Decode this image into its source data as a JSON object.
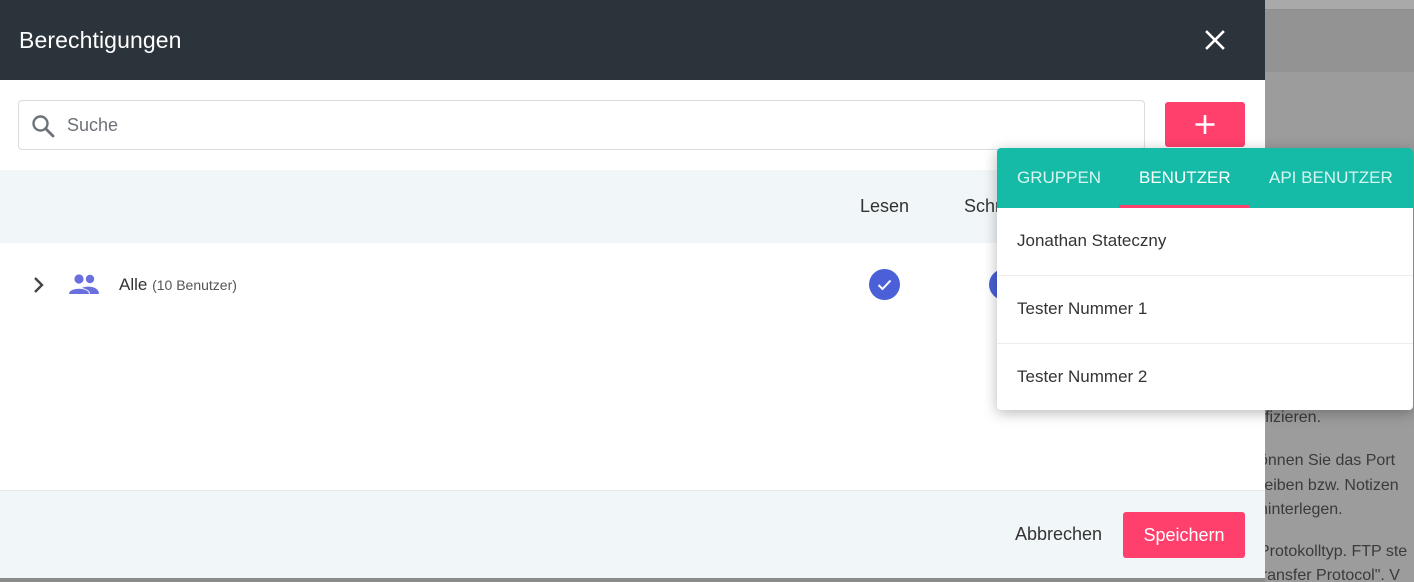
{
  "background": {
    "lines": [
      "fizieren.",
      "önnen Sie das Port",
      "reiben bzw. Notizen",
      " hinterlegen.",
      "Protokolltyp. FTP ste",
      "\"File Transfer Protocol\". V"
    ]
  },
  "dialog": {
    "title": "Berechtigungen",
    "close_icon": "close-icon",
    "search": {
      "placeholder": "Suche",
      "value": ""
    },
    "add_icon": "plus-icon",
    "columns": {
      "read": "Lesen",
      "write": "Schr"
    },
    "rows": [
      {
        "label": "Alle",
        "sub": "(10 Benutzer)",
        "read": true,
        "write": true
      }
    ],
    "footer": {
      "cancel_label": "Abbrechen",
      "save_label": "Speichern"
    }
  },
  "popup": {
    "tabs": [
      {
        "label": "Gruppen",
        "active": false
      },
      {
        "label": "Benutzer",
        "active": true
      },
      {
        "label": "API Benutzer",
        "active": false
      }
    ],
    "items": [
      "Jonathan Stateczny",
      "Tester Nummer 1",
      "Tester Nummer 2"
    ]
  },
  "colors": {
    "header_bg": "#2b333b",
    "accent_pink": "#ff3f6c",
    "tab_bar_teal": "#15bba6",
    "check_blue": "#4a5fd8",
    "group_icon_purple": "#6a6fe0"
  }
}
